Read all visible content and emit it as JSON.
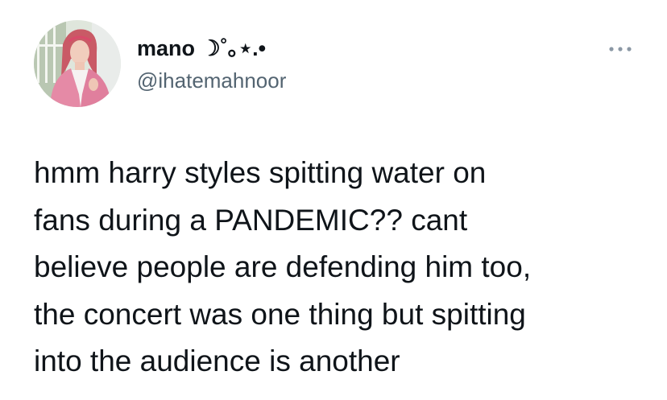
{
  "user": {
    "display_name": "mano ☽˚｡⋆.•",
    "handle": "@ihatemahnoor",
    "avatar_icon": "profile-photo"
  },
  "more_icon": "more-options-icon",
  "tweet": {
    "text": "hmm harry styles spitting water on\nfans during a PANDEMIC?? cant\nbelieve people are defending him too,\nthe concert was one thing but spitting\ninto the audience is another"
  },
  "colors": {
    "text_primary": "#0f1419",
    "text_secondary": "#536471",
    "background": "#ffffff"
  }
}
